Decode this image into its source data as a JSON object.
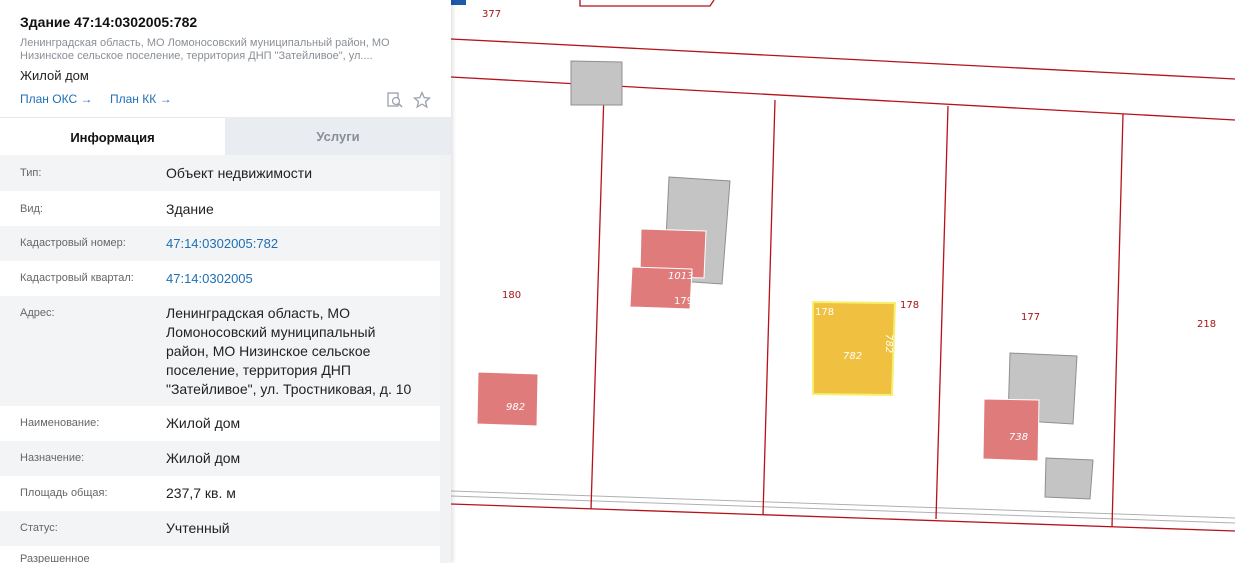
{
  "header": {
    "title": "Здание 47:14:0302005:782",
    "address_short": "Ленинградская область, МО Ломоносовский муниципальный район, МО Низинское сельское поселение, территория ДНП \"Затейливое\", ул....",
    "object_kind": "Жилой дом",
    "link_oks": "План ОКС →",
    "link_kk": "План КК →",
    "icons": [
      "search-document-icon",
      "star-icon"
    ]
  },
  "tabs": {
    "info": "Информация",
    "services": "Услуги"
  },
  "details": [
    {
      "label": "Тип:",
      "value": "Объект недвижимости"
    },
    {
      "label": "Вид:",
      "value": "Здание"
    },
    {
      "label": "Кадастровый номер:",
      "value": "47:14:0302005:782"
    },
    {
      "label": "Кадастровый квартал:",
      "value": "47:14:0302005"
    },
    {
      "label": "Адрес:",
      "value_lines": [
        "Ленинградская область, МО",
        "Ломоносовский муниципальный",
        "район, МО Низинское сельское",
        "поселение, территория ДНП",
        "\"Затейливое\", ул. Тростниковая, д. 10"
      ]
    },
    {
      "label": "Наименование:",
      "value": "Жилой дом"
    },
    {
      "label": "Назначение:",
      "value": "Жилой дом"
    },
    {
      "label": "Площадь общая:",
      "value": "237,7 кв. м"
    },
    {
      "label": "Статус:",
      "value": "Учтенный"
    },
    {
      "label": "Разрешенное",
      "value": ""
    }
  ],
  "map": {
    "parcel_labels": [
      "377",
      "180",
      "179",
      "178",
      "178",
      "177",
      "218"
    ],
    "building_labels": [
      "1013",
      "982",
      "782",
      "782",
      "738"
    ],
    "colors": {
      "parcel_line": "#b5121b",
      "building_red": "#e07b7b",
      "building_gray": "#c4c4c4",
      "selected": "#f0c040",
      "selected_border": "#f7f06e",
      "accent": "#1e5aa8",
      "link": "#1f6fb5"
    }
  }
}
